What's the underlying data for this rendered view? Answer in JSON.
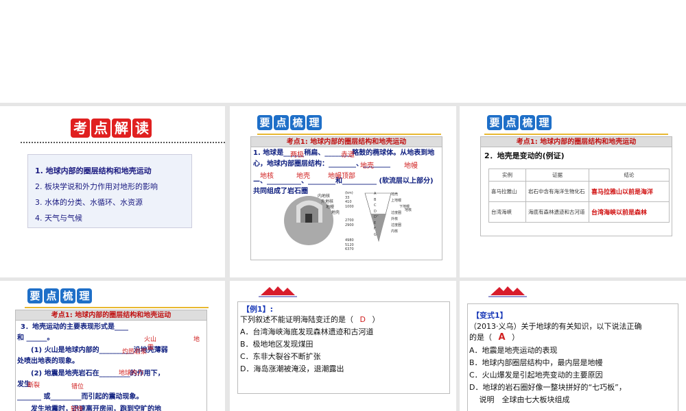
{
  "slides": {
    "s1": {
      "tiles": [
        "考",
        "点",
        "解",
        "读"
      ],
      "items": [
        "1. 地球内部的圈层结构和地壳运动",
        "2. 板块学说和外力作用对地形的影响",
        "3. 水体的分类、水循环、水资源",
        "4. 天气与气候"
      ]
    },
    "s2": {
      "tiles": [
        "要",
        "点",
        "梳",
        "理"
      ],
      "heading": "考点1: 地球内部的圈层结构和地壳运动",
      "line1": "1. 地球是______稍扁、________略鼓的椭球体。从地表到地心，地球内部圈层结构：________、________",
      "line2": "—、__________、________和__________ (软流层以上部分)",
      "line3": "共同组成了岩石圈",
      "answers": [
        "两极",
        "赤道",
        "地壳",
        "地幔",
        "地核",
        "地壳",
        "地幔顶部"
      ],
      "diagram_labels": [
        "内地核",
        "外地核",
        "地幔",
        "地壳"
      ],
      "depths": [
        "(km)",
        "33",
        "410",
        "1000",
        "2700",
        "2900",
        "4980",
        "5120",
        "6370"
      ],
      "layers": [
        "A",
        "B",
        "C",
        "D",
        "D''",
        "E",
        "F",
        "G"
      ],
      "zones": [
        "地壳",
        "上地幔",
        "下地幔",
        "过度圈",
        "外核",
        "过度圈",
        "内核",
        "地核"
      ]
    },
    "s3": {
      "tiles": [
        "要",
        "点",
        "梳",
        "理"
      ],
      "heading": "考点1: 地球内部的圈层结构和地壳运动",
      "subtitle": "2．地壳是变动的(例证)",
      "table": {
        "headers": [
          "实例",
          "证据",
          "结论"
        ],
        "rows": [
          [
            "喜马拉雅山",
            "岩石中含有海洋生物化石",
            "喜马拉雅山以前是海洋"
          ],
          [
            "台湾海峡",
            "海底有森林遗迹和古河道",
            "台湾海峡以前是森林"
          ]
        ]
      }
    },
    "s4": {
      "tiles": [
        "要",
        "点",
        "梳",
        "理"
      ],
      "heading": "考点1: 地球内部的圈层结构和地壳运动",
      "lines": [
        "3．地壳运动的主要表现形式是____",
        "和 ______。",
        "(1) 火山是地球内部的__________沿地壳薄弱",
        "处喷出地表的现象。",
        "(2) 地震是地壳岩石在_________的作用下，",
        "发生",
        "_______ 或_________而引起的震动现象。",
        "发生地震时，迅速离开房间，跑到空旷的地"
      ],
      "answers": [
        "火山",
        "地",
        "震",
        "灼热岩浆",
        "地球内力",
        "断裂",
        "错位",
        "较快"
      ]
    },
    "s5": {
      "label": "【例1】:",
      "question": "下列叙述不能证明海陆变迁的是（",
      "answer": "D",
      "close": "）",
      "options": [
        "A．台湾海峡海底发现森林遗迹和古河道",
        "B．极地地区发现煤田",
        "C．东非大裂谷不断扩张",
        "D．海岛涨潮被淹没，退潮露出"
      ]
    },
    "s6": {
      "label": "【变式1】",
      "question1": "（2013·义乌）关于地球的有关知识，以下说法正确",
      "question2": "的是（",
      "answer": "A",
      "close": "）",
      "options": [
        "A．地震是地壳运动的表现",
        "B．地球内部圈层结构中，最内层是地幔",
        "C．火山爆发是引起地壳变动的主要原因",
        "D．地球的岩石圈好像一整块拼好的“七巧板”，",
        "　 说明　全球由七大板块组成"
      ]
    }
  }
}
